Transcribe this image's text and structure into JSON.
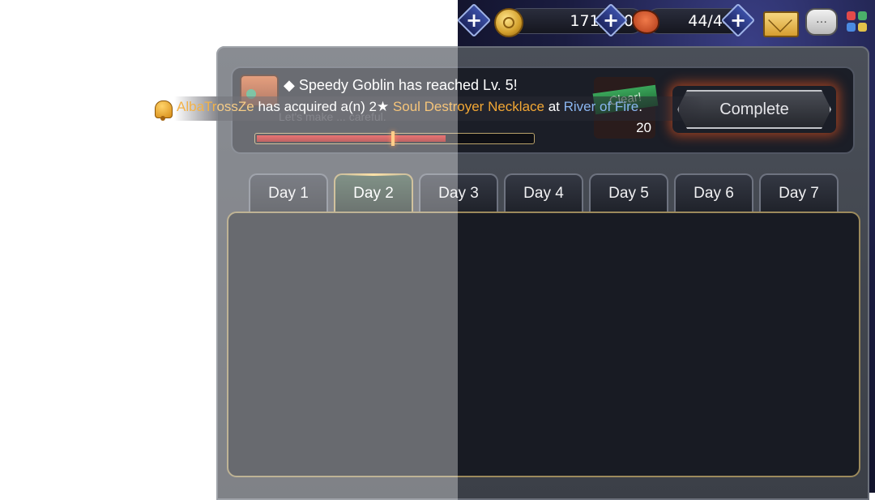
{
  "topbar": {
    "gold": "171,500",
    "stamina": "44/44",
    "plus_symbol": "+",
    "chat_glyph": "…",
    "colors": {
      "accent_blue": "#3b4fa6",
      "coin": "#d3a02c"
    }
  },
  "mission": {
    "title": "◆ Speedy Goblin has reached Lv. 5!",
    "description": "Let's make ... careful.",
    "progress_percent": 0.72,
    "reward_tag": "Clear!",
    "reward_count": "20",
    "complete_label": "Complete"
  },
  "ticker": {
    "user": "AlbaTrossZe",
    "text_mid": " has acquired a(n) 2★ ",
    "item": "Soul Destroyer Necklace",
    "text_at": " at ",
    "place": "River of Fire",
    "text_end": "."
  },
  "tabs": [
    {
      "label": "Day 1",
      "active": false
    },
    {
      "label": "Day 2",
      "active": true
    },
    {
      "label": "Day 3",
      "active": false
    },
    {
      "label": "Day 4",
      "active": false
    },
    {
      "label": "Day 5",
      "active": false
    },
    {
      "label": "Day 6",
      "active": false
    },
    {
      "label": "Day 7",
      "active": false
    }
  ],
  "icons": [
    "plus-icon",
    "gold-coin-icon",
    "meat-icon",
    "mail-icon",
    "chat-icon",
    "menu-grid-icon",
    "bell-icon",
    "mission-chest-icon"
  ]
}
